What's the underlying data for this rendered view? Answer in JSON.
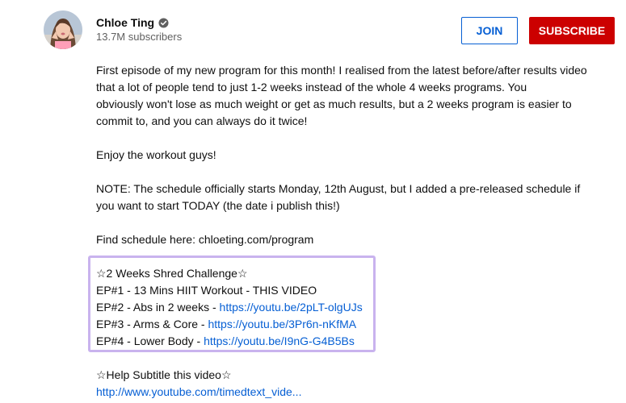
{
  "channel": {
    "name": "Chloe Ting",
    "subscribers": "13.7M subscribers",
    "avatar_icon": "avatar-photo",
    "verified_icon": "verified-check-icon"
  },
  "buttons": {
    "join": "JOIN",
    "subscribe": "SUBSCRIBE"
  },
  "description": {
    "para1": [
      "First episode of my new program for this month! I realised from the latest before/after results video",
      "that a lot of people tend to just 1-2 weeks instead of the whole 4 weeks programs. You",
      "obviously won't lose as much weight or get as much results, but a 2 weeks program is easier to",
      "commit to, and you can always do it twice!"
    ],
    "para2": "Enjoy the workout guys!",
    "para3": [
      "NOTE: The schedule officially starts Monday, 12th August, but I added a pre-released schedule if",
      "you want to start TODAY (the date i publish this!)"
    ],
    "schedule": "Find schedule here: chloeting.com/program",
    "challenge": {
      "title": "☆2 Weeks Shred Challenge☆",
      "ep1": "EP#1 - 13 Mins HIIT Workout - THIS VIDEO",
      "ep2_text": "EP#2 - Abs in 2 weeks - ",
      "ep2_link": "https://youtu.be/2pLT-olgUJs",
      "ep3_text": "EP#3 - Arms & Core - ",
      "ep3_link": "https://youtu.be/3Pr6n-nKfMA",
      "ep4_text": "EP#4 - Lower Body - ",
      "ep4_link": "https://youtu.be/I9nG-G4B5Bs"
    },
    "subtitle_title": "☆Help Subtitle this video☆",
    "subtitle_link": "http://www.youtube.com/timedtext_vide..."
  },
  "colors": {
    "link": "#065fd4",
    "subscribe_bg": "#cc0000",
    "highlight_border": "#c9b3ee"
  }
}
